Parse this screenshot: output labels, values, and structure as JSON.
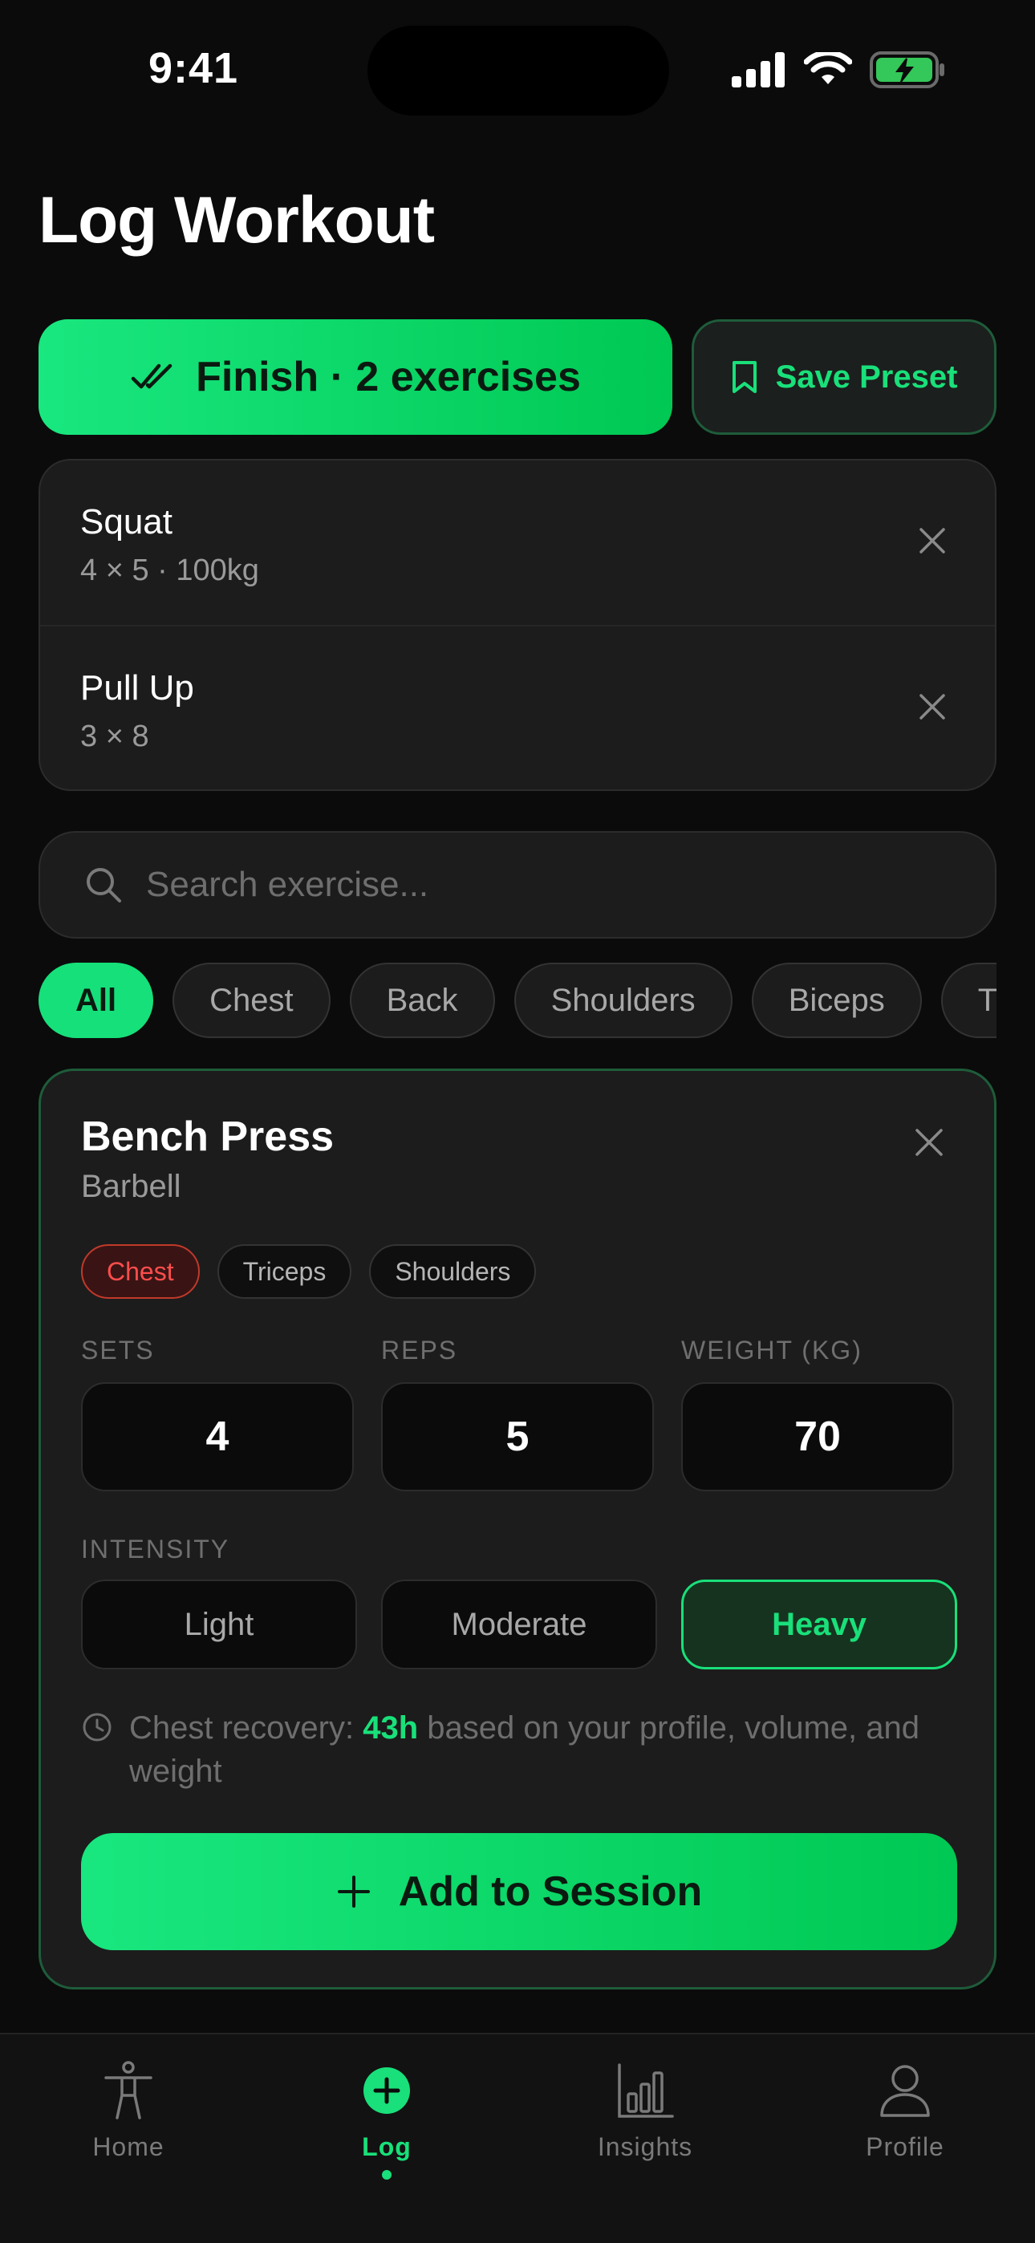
{
  "status_bar": {
    "time": "9:41",
    "icons": [
      "signal-icon",
      "wifi-icon",
      "battery-charging-icon"
    ]
  },
  "header": {
    "title": "Log Workout"
  },
  "actions": {
    "finish_label": "Finish · 2 exercises",
    "finish_icon": "double-check-icon",
    "save_label": "Save Preset",
    "save_icon": "bookmark-icon"
  },
  "session": {
    "items": [
      {
        "name": "Squat",
        "detail": "4 × 5 · 100kg"
      },
      {
        "name": "Pull Up",
        "detail": "3 × 8"
      }
    ]
  },
  "search": {
    "placeholder": "Search exercise..."
  },
  "filters": {
    "chips": [
      "All",
      "Chest",
      "Back",
      "Shoulders",
      "Biceps",
      "T"
    ],
    "selected": "All"
  },
  "exercise": {
    "name": "Bench Press",
    "equipment": "Barbell",
    "tags": [
      "Chest",
      "Triceps",
      "Shoulders"
    ],
    "sets_label": "SETS",
    "reps_label": "REPS",
    "weight_label": "WEIGHT (KG)",
    "sets": "4",
    "reps": "5",
    "weight": "70",
    "intensity_label": "INTENSITY",
    "intensity_options": [
      "Light",
      "Moderate",
      "Heavy"
    ],
    "intensity_selected": "Heavy",
    "recovery_prefix": "Chest recovery: ",
    "recovery_hours": "43h",
    "recovery_suffix": " based on your profile, volume, and weight",
    "add_label": "Add to Session"
  },
  "nav": {
    "tabs": [
      {
        "label": "Home",
        "icon": "body-icon"
      },
      {
        "label": "Log",
        "icon": "plus-circle-icon"
      },
      {
        "label": "Insights",
        "icon": "bar-chart-icon"
      },
      {
        "label": "Profile",
        "icon": "user-icon"
      }
    ],
    "active": "Log"
  },
  "colors": {
    "accent": "#19e07a",
    "background": "#0b0b0b",
    "card": "#1c1c1c",
    "muscle_primary": "#ff4d4d"
  }
}
